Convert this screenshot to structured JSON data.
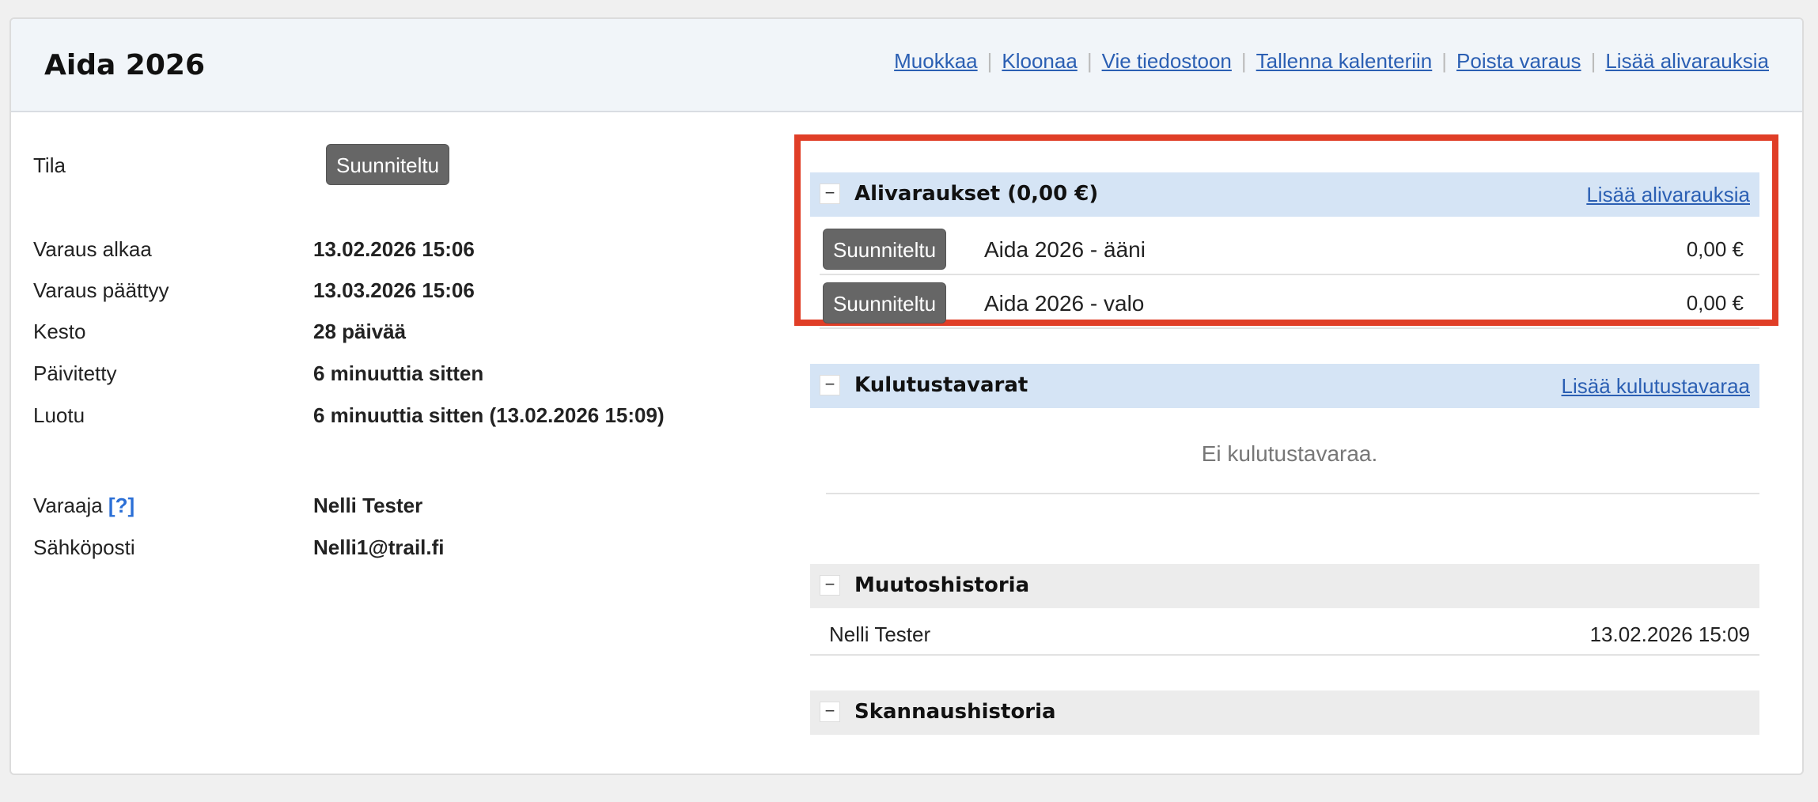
{
  "header": {
    "title": "Aida 2026",
    "actions": [
      "Muokkaa",
      "Kloonaa",
      "Vie tiedostoon",
      "Tallenna kalenteriin",
      "Poista varaus",
      "Lisää alivarauksia"
    ]
  },
  "details": {
    "status_label": "Tila",
    "status_value": "Suunniteltu",
    "start_label": "Varaus alkaa",
    "start_value": "13.02.2026 15:06",
    "end_label": "Varaus päättyy",
    "end_value": "13.03.2026 15:06",
    "duration_label": "Kesto",
    "duration_value": "28 päivää",
    "updated_label": "Päivitetty",
    "updated_value": "6 minuuttia sitten",
    "created_label": "Luotu",
    "created_value": "6 minuuttia sitten (13.02.2026 15:09)",
    "booker_label": "Varaaja",
    "booker_help": "[?]",
    "booker_value": "Nelli Tester",
    "email_label": "Sähköposti",
    "email_value": "Nelli1@trail.fi"
  },
  "subbookings": {
    "toggle": "−",
    "title": "Alivaraukset (0,00 €)",
    "add_link": "Lisää alivarauksia",
    "items": [
      {
        "status": "Suunniteltu",
        "name": "Aida 2026 - ääni",
        "price": "0,00 €"
      },
      {
        "status": "Suunniteltu",
        "name": "Aida 2026 - valo",
        "price": "0,00 €"
      }
    ]
  },
  "consumables": {
    "toggle": "−",
    "title": "Kulutustavarat",
    "add_link": "Lisää kulutustavaraa",
    "empty": "Ei kulutustavaraa."
  },
  "history": {
    "toggle": "−",
    "title": "Muutoshistoria",
    "rows": [
      {
        "name": "Nelli Tester",
        "date": "13.02.2026 15:09"
      }
    ]
  },
  "scan_history": {
    "toggle": "−",
    "title": "Skannaushistoria"
  },
  "colors": {
    "highlight": "#e03e27",
    "link": "#2b5fb3",
    "status_bg": "#666666",
    "section_blue": "#d5e4f5",
    "section_gray": "#ececec"
  }
}
